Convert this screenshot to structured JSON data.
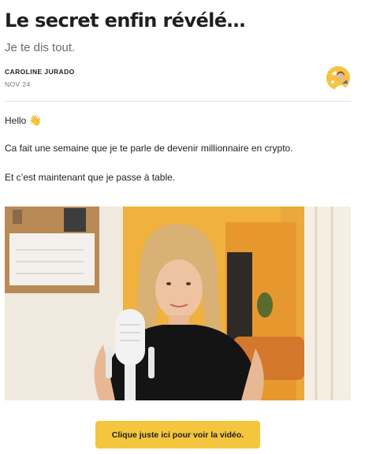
{
  "post": {
    "title": "Le secret enfin révélé…",
    "subtitle": "Je te dis tout.",
    "author": "CAROLINE JURADO",
    "date": "NOV 24",
    "paragraphs": {
      "greeting": "Hello",
      "greeting_emoji": "👋",
      "line1": "Ca fait une semaine que je te parle de devenir millionnaire en crypto.",
      "line2": "Et c’est maintenant que je passe à table."
    },
    "cta_label": "Clique juste ici pour voir la vidéo."
  },
  "colors": {
    "accent": "#f4c63d",
    "divider": "#e2e2e2",
    "subtitle": "#6b6b6b"
  },
  "icons": {
    "avatar": "author-avatar",
    "emoji": "waving-hand"
  }
}
